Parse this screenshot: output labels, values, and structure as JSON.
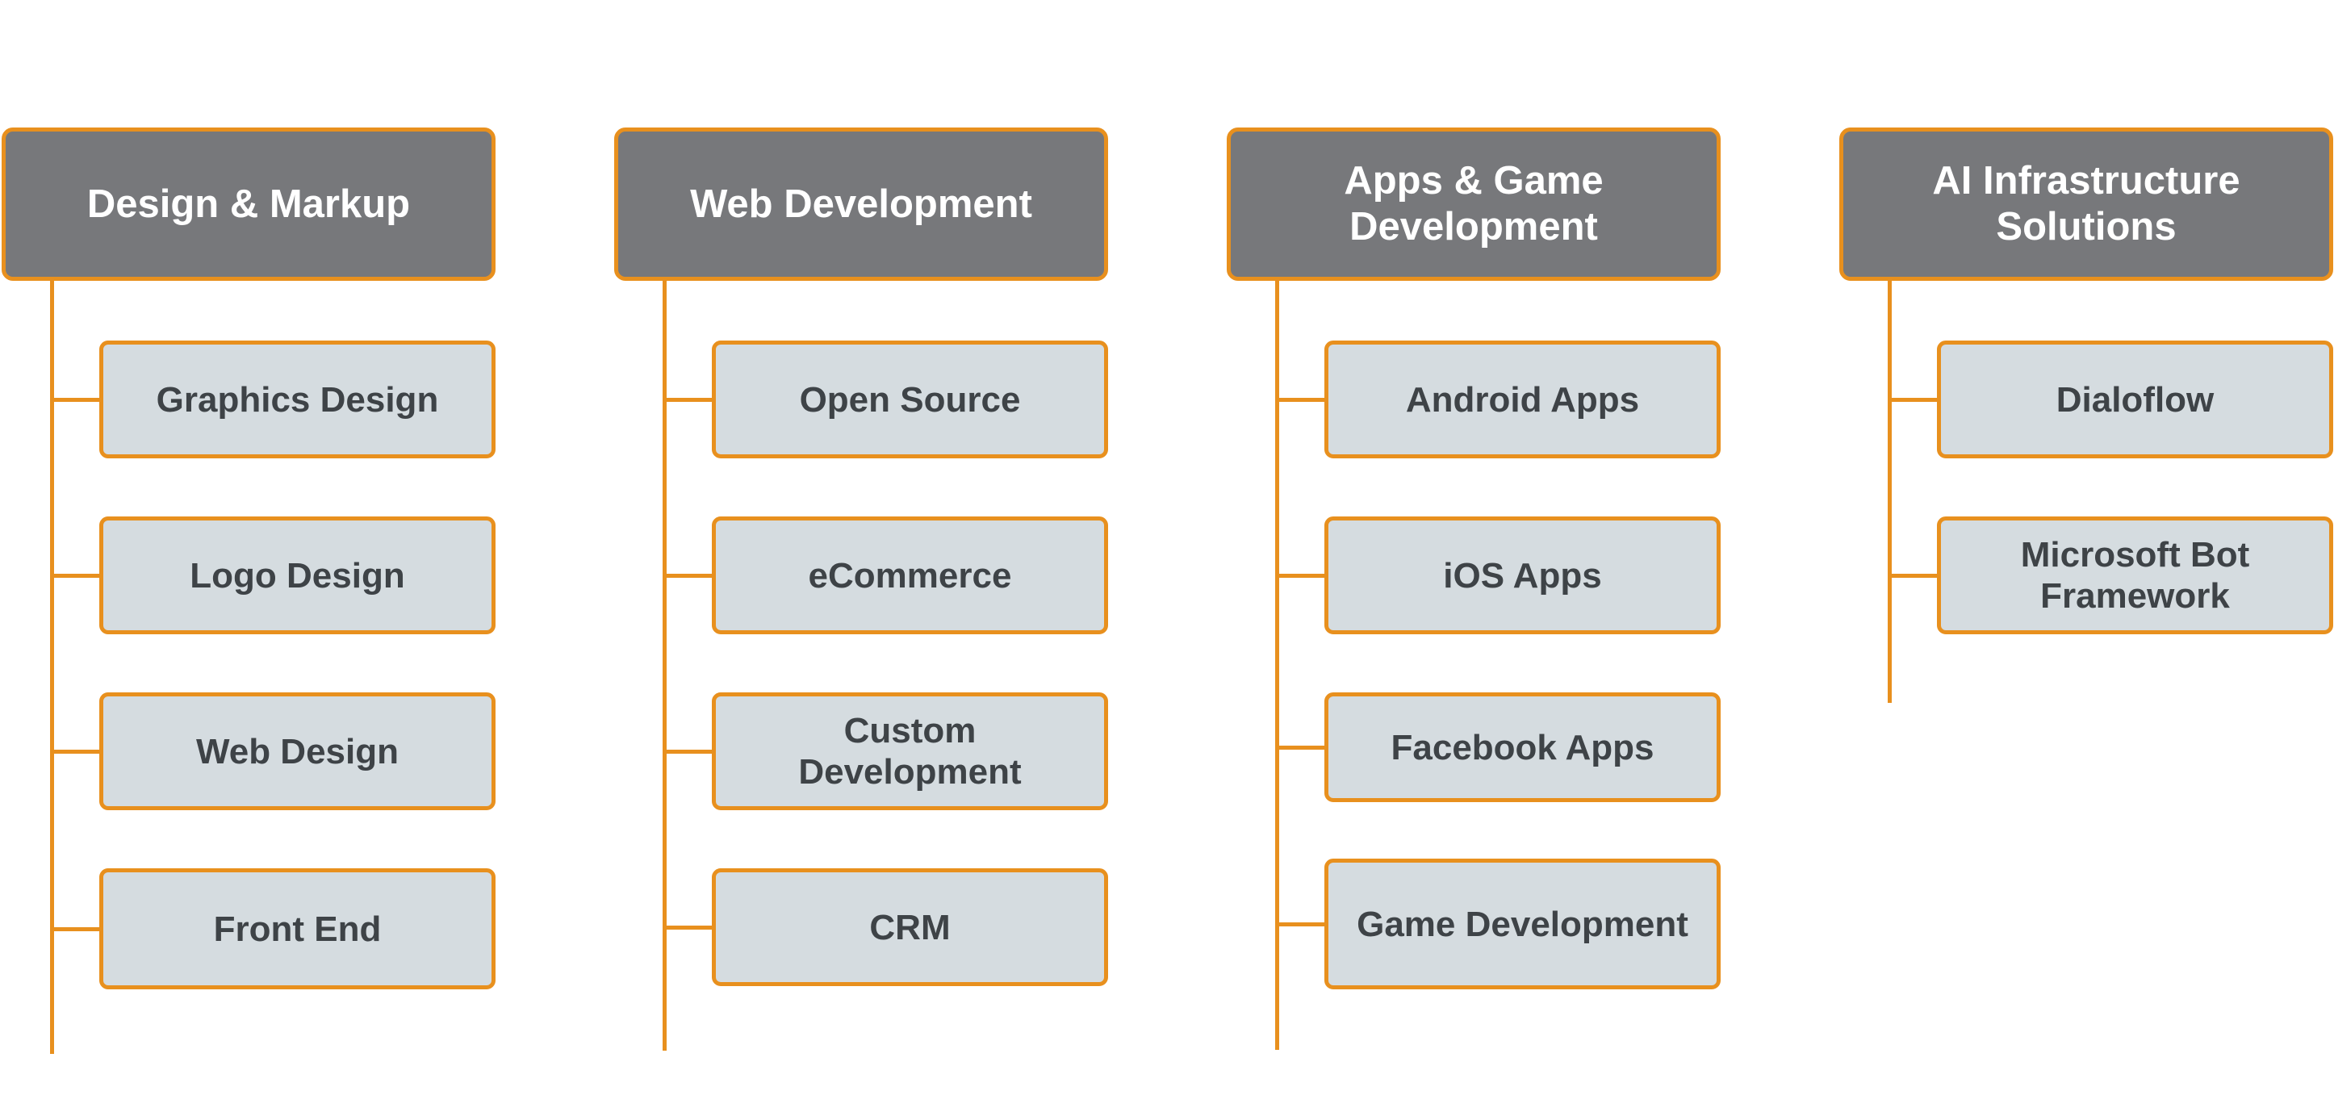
{
  "colors": {
    "accent_orange": "#e8901e",
    "header_fill": "#77787b",
    "header_text": "#ffffff",
    "item_fill": "#d5dce0",
    "item_text": "#3e4347"
  },
  "categories": [
    {
      "title": "Design & Markup",
      "items": [
        "Graphics Design",
        "Logo Design",
        "Web Design",
        "Front End"
      ]
    },
    {
      "title": "Web Development",
      "items": [
        "Open Source",
        "eCommerce",
        "Custom Development",
        "CRM"
      ]
    },
    {
      "title": "Apps & Game Development",
      "items": [
        "Android Apps",
        "iOS Apps",
        "Facebook Apps",
        "Game Development"
      ]
    },
    {
      "title": "AI Infrastructure Solutions",
      "items": [
        "Dialoflow",
        "Microsoft Bot Framework"
      ]
    }
  ]
}
